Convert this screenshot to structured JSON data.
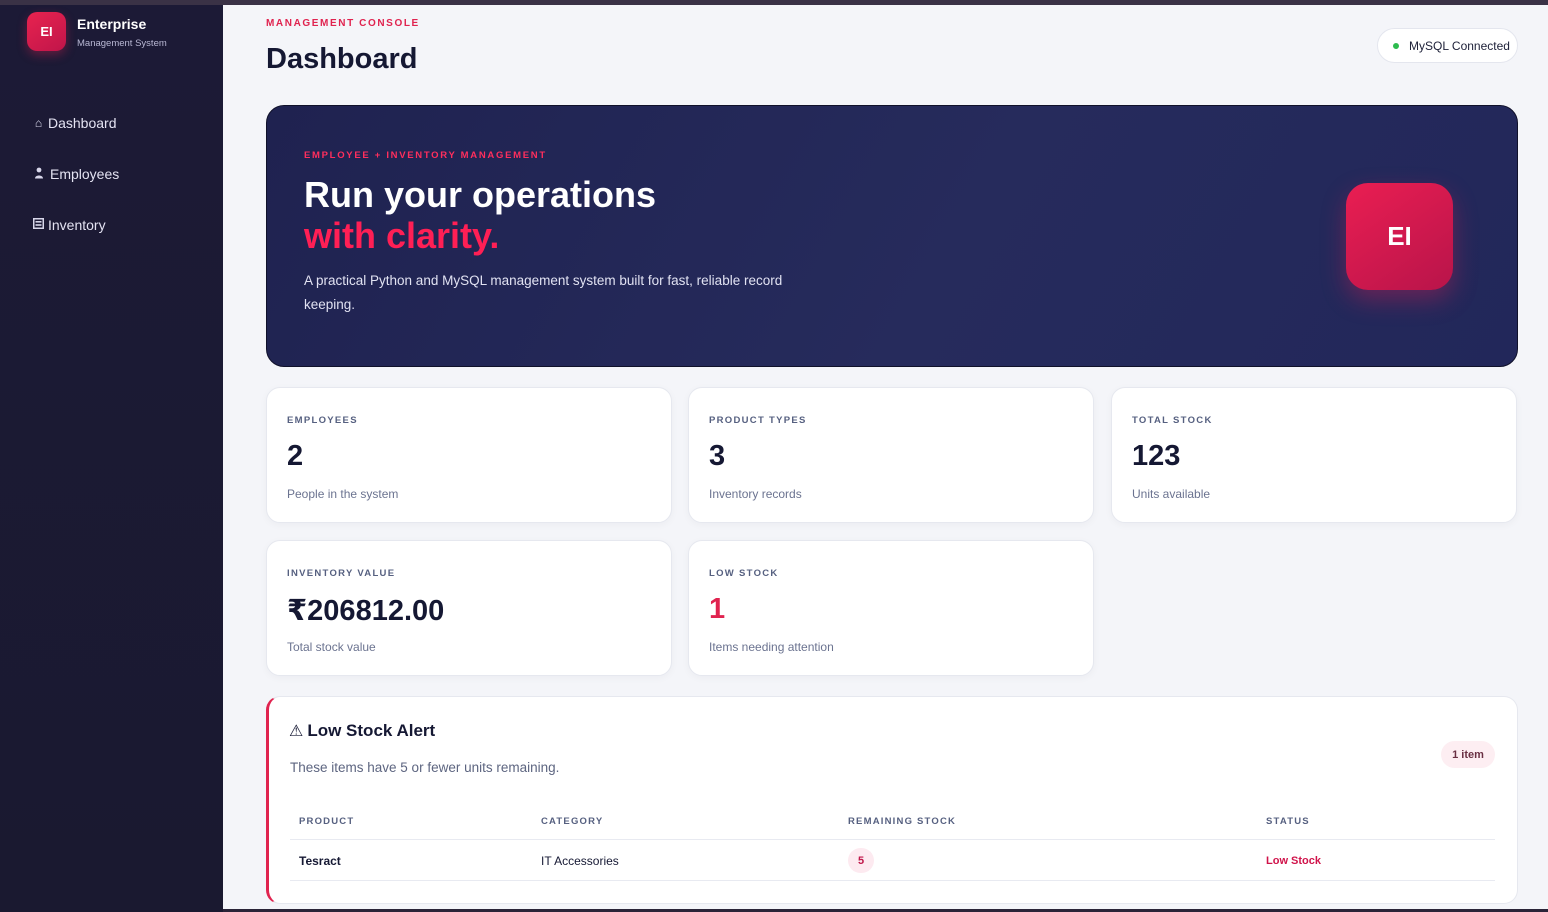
{
  "sidebar": {
    "brand": {
      "logo_text": "EI",
      "name": "Enterprise",
      "subtitle": "Management System"
    },
    "items": [
      {
        "icon": "⌂",
        "icon_name": "home-icon",
        "label": "Dashboard"
      },
      {
        "icon": "👤",
        "icon_name": "user-icon",
        "label": "Employees"
      },
      {
        "icon": "▤",
        "icon_name": "box-icon",
        "label": "Inventory"
      }
    ]
  },
  "header": {
    "eyebrow": "MANAGEMENT CONSOLE",
    "title": "Dashboard",
    "status": "MySQL Connected"
  },
  "hero": {
    "eyebrow": "EMPLOYEE + INVENTORY MANAGEMENT",
    "title_line1": "Run your operations",
    "title_line2": "with clarity.",
    "description": "A practical Python and MySQL management system built for fast, reliable record keeping.",
    "logo_text": "EI"
  },
  "stats": [
    {
      "label": "EMPLOYEES",
      "value": "2",
      "sub": "People in the system"
    },
    {
      "label": "PRODUCT TYPES",
      "value": "3",
      "sub": "Inventory records"
    },
    {
      "label": "TOTAL STOCK",
      "value": "123",
      "sub": "Units available"
    },
    {
      "label": "INVENTORY VALUE",
      "value": "₹206812.00",
      "sub": "Total stock value"
    },
    {
      "label": "LOW STOCK",
      "value": "1",
      "sub": "Items needing attention"
    }
  ],
  "alert": {
    "icon": "⚠",
    "title": "Low Stock Alert",
    "description": "These items have 5 or fewer units remaining.",
    "badge": "1 item",
    "columns": [
      "PRODUCT",
      "CATEGORY",
      "REMAINING STOCK",
      "STATUS"
    ],
    "rows": [
      {
        "product": "Tesract",
        "category": "IT Accessories",
        "stock": "5",
        "status": "Low Stock"
      }
    ]
  },
  "colors": {
    "accent": "#e0234f",
    "sidebar_bg": "#1c1a36",
    "hero_bg": "#22265a",
    "status_ok": "#2dbb4e"
  }
}
